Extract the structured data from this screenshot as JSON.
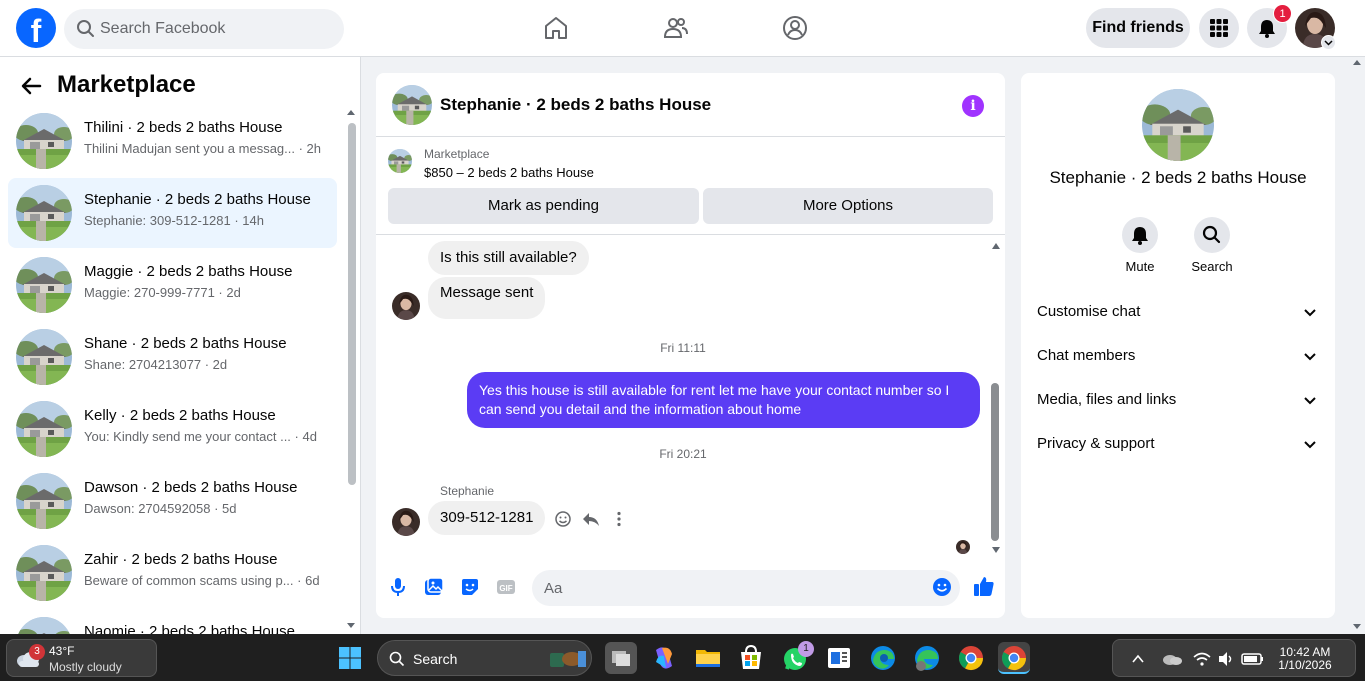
{
  "header": {
    "search_placeholder": "Search Facebook",
    "find_friends": "Find friends",
    "notification_count": "1",
    "logo_letter": "f"
  },
  "sidebar": {
    "title": "Marketplace",
    "conversations": [
      {
        "name": "Thilini · 2 beds 2 baths House",
        "preview": "Thilini Madujan sent you a messag... · 2h"
      },
      {
        "name": "Stephanie · 2 beds 2 baths House",
        "preview": "Stephanie: 309-512-1281 · 14h"
      },
      {
        "name": "Maggie · 2 beds 2 baths House",
        "preview": "Maggie: 270-999-7771 · 2d"
      },
      {
        "name": "Shane · 2 beds 2 baths House",
        "preview": "Shane: 2704213077 · 2d"
      },
      {
        "name": "Kelly · 2 beds 2 baths House",
        "preview": "You: Kindly send me your contact ... · 4d"
      },
      {
        "name": "Dawson · 2 beds 2 baths House",
        "preview": "Dawson: 2704592058 · 5d"
      },
      {
        "name": "Zahir · 2 beds 2 baths House",
        "preview": "Beware of common scams using p... · 6d"
      },
      {
        "name": "Naomie · 2 beds 2 baths House",
        "preview": ""
      }
    ]
  },
  "chat": {
    "title": "Stephanie · 2 beds 2 baths House",
    "listing_source": "Marketplace",
    "listing_price": "$850 – 2 beds 2 baths House",
    "mark_pending": "Mark as pending",
    "more_options": "More Options",
    "messages": {
      "m1": "Is this still available?",
      "m2": "Message sent",
      "ts1": "Fri 11:11",
      "out1": "Yes this house is still available for rent let me have your contact number so I can send you detail and the information about home",
      "ts2": "Fri 20:21",
      "sender": "Stephanie",
      "m3": "309-512-1281"
    },
    "composer_placeholder": "Aa"
  },
  "info_panel": {
    "name": "Stephanie · 2 beds 2 baths House",
    "mute": "Mute",
    "search": "Search",
    "sections": [
      "Customise chat",
      "Chat members",
      "Media, files and links",
      "Privacy & support"
    ]
  },
  "taskbar": {
    "weather_temp": "43°F",
    "weather_cond": "Mostly cloudy",
    "weather_badge": "3",
    "search_label": "Search",
    "whatsapp_badge": "1",
    "time": "10:42 AM",
    "date": "1/10/2026"
  },
  "colors": {
    "brand": "#0866ff",
    "outgoing_bubble": "#5b3cf4",
    "info_icon": "#a033ff",
    "active_conv": "#ebf5ff"
  }
}
